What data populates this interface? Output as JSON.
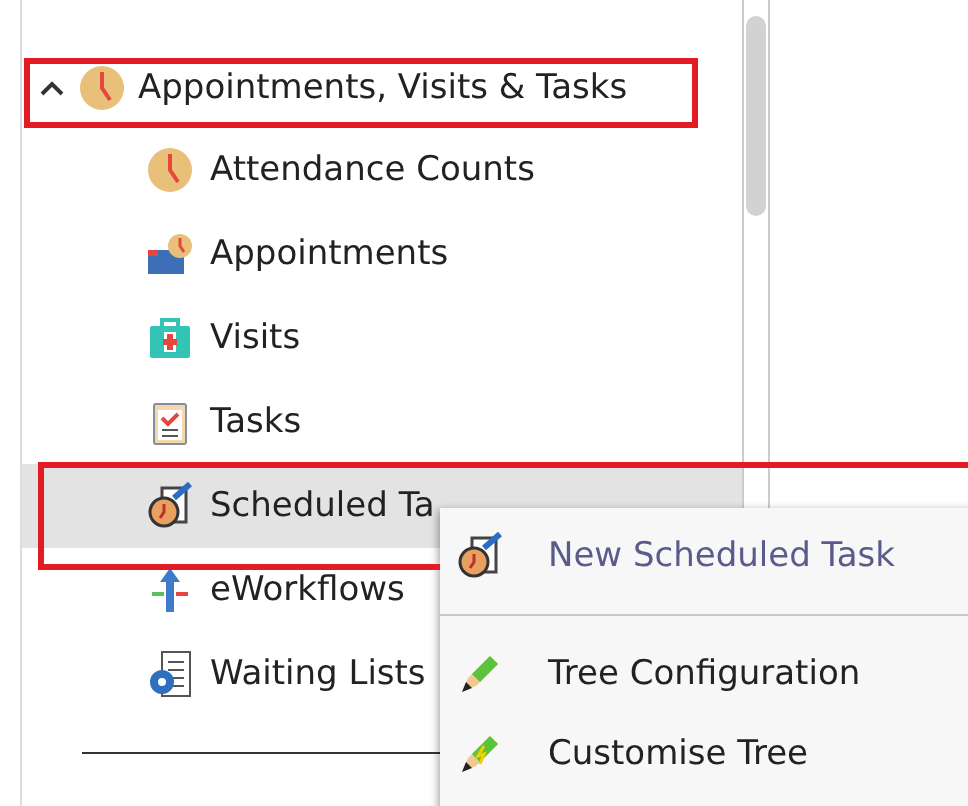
{
  "tree": {
    "label": "Appointments, Visits & Tasks",
    "expanded": true,
    "kind": "clock",
    "children": [
      {
        "label": "Attendance Counts",
        "kind": "clock",
        "selected": false
      },
      {
        "label": "Appointments",
        "kind": "calendar",
        "selected": false
      },
      {
        "label": "Visits",
        "kind": "medkit",
        "selected": false
      },
      {
        "label": "Tasks",
        "kind": "clipboard",
        "selected": false
      },
      {
        "label": "Scheduled Ta",
        "kind": "scheduled",
        "selected": true
      },
      {
        "label": "eWorkflows",
        "kind": "workflow",
        "selected": false
      },
      {
        "label": "Waiting Lists",
        "kind": "list",
        "selected": false
      }
    ]
  },
  "context_menu": {
    "items": [
      {
        "kind": "scheduled",
        "label": "New Scheduled Task",
        "selected": true
      },
      {
        "kind": "separator"
      },
      {
        "kind": "pencil",
        "label": "Tree Configuration",
        "selected": false
      },
      {
        "kind": "pencilbolt",
        "label": "Customise Tree",
        "selected": false
      }
    ]
  }
}
